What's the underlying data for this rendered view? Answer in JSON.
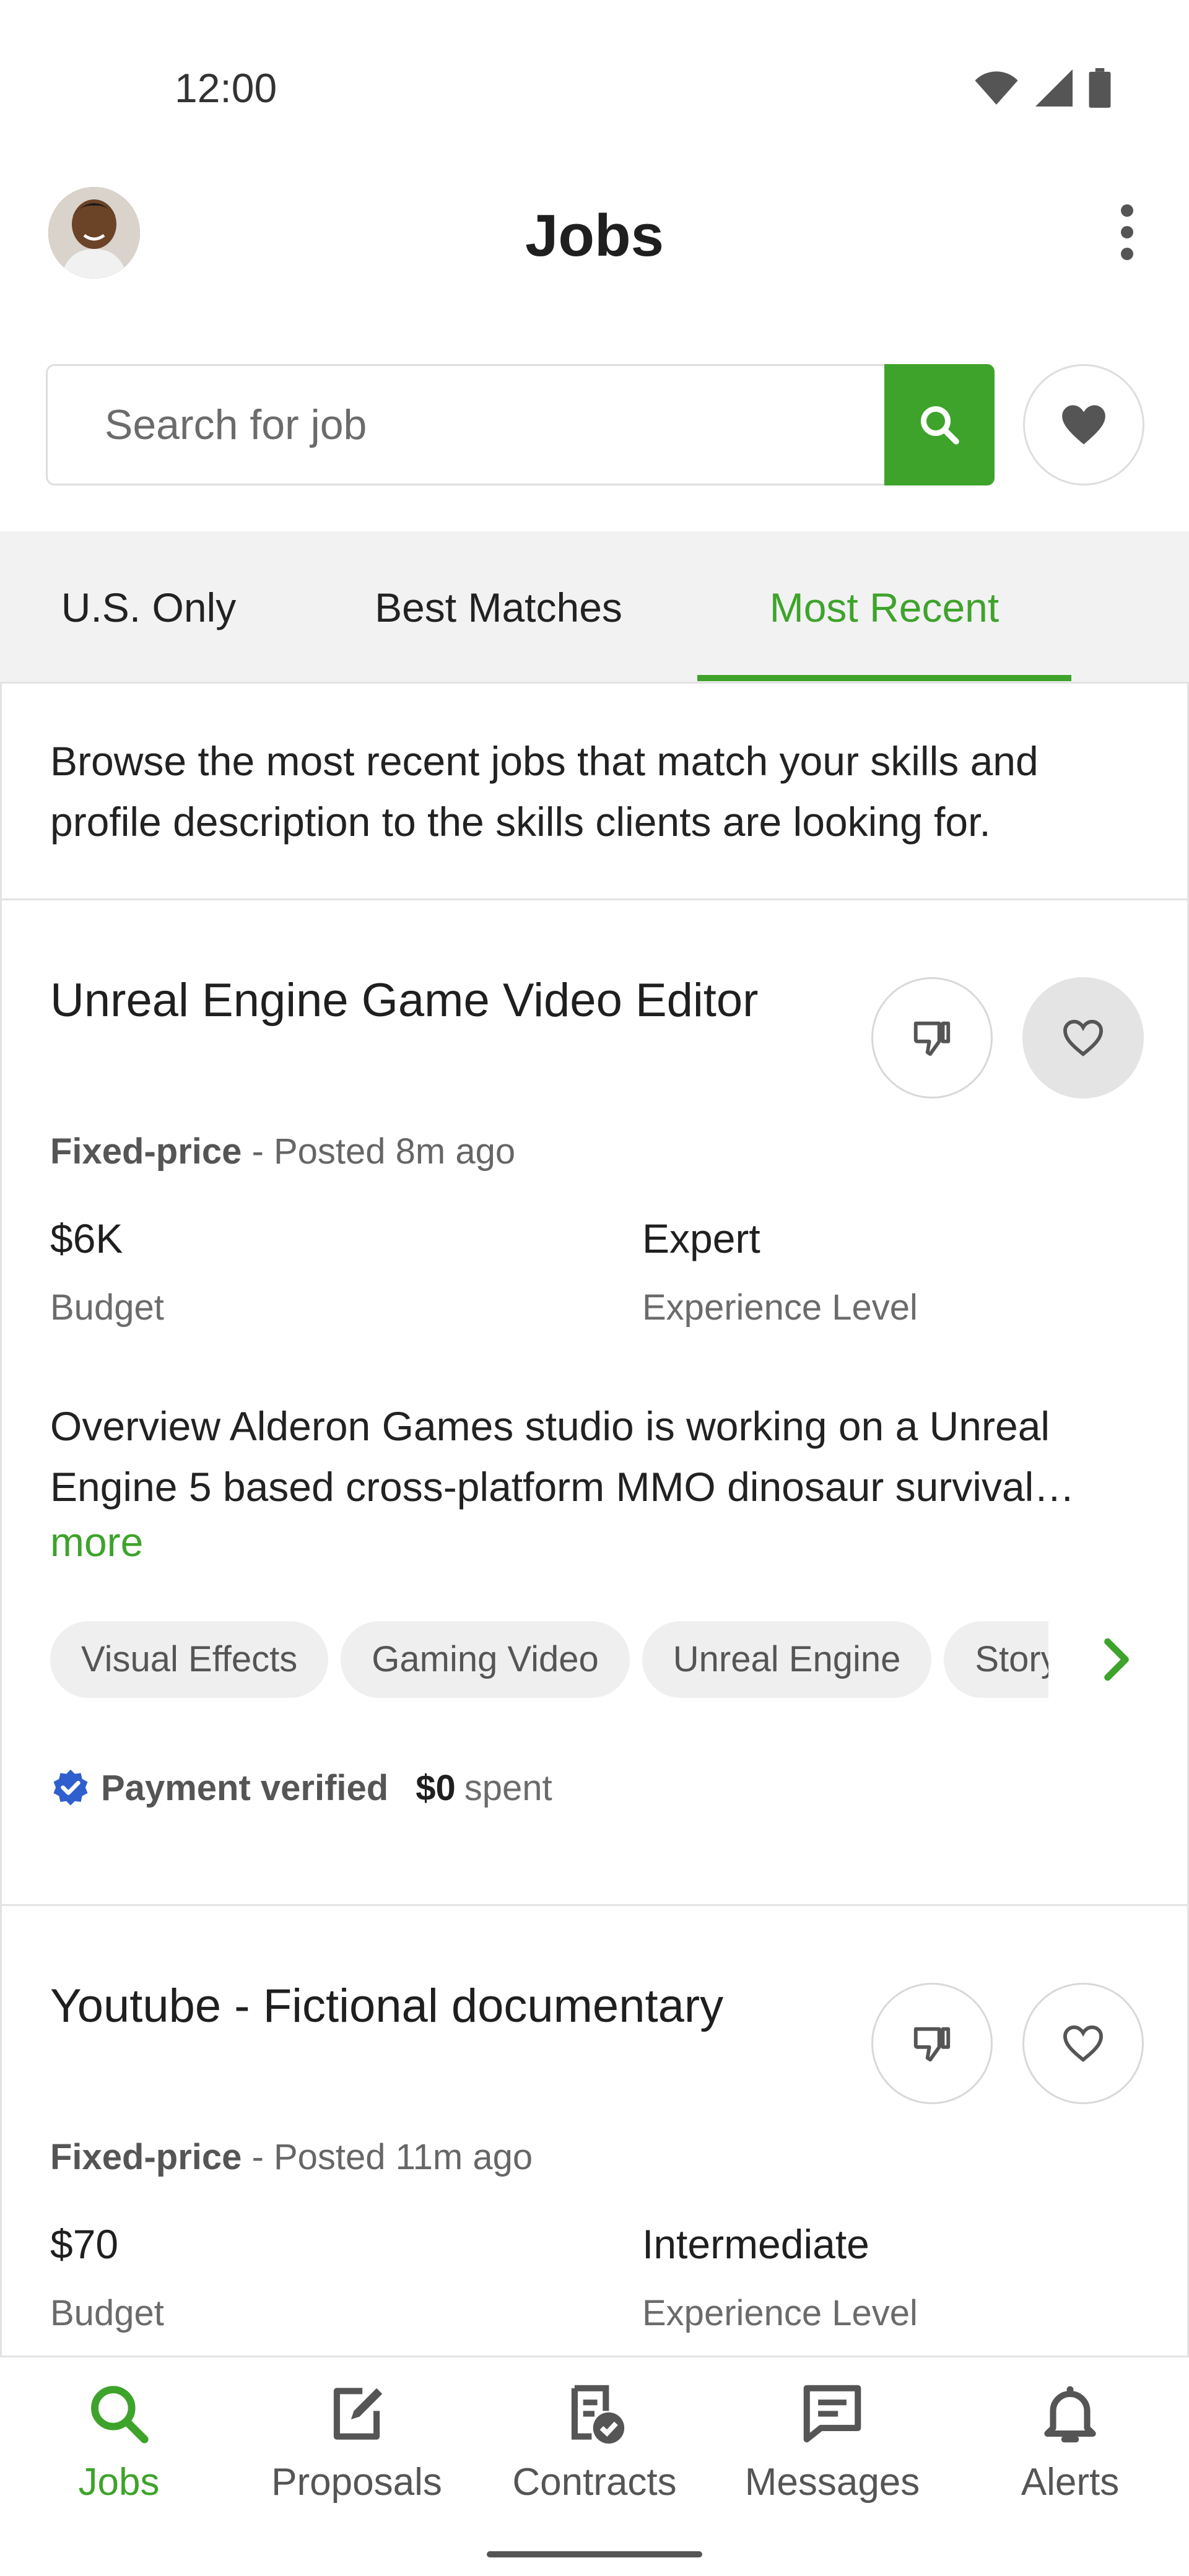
{
  "status_bar": {
    "time": "12:00"
  },
  "header": {
    "title": "Jobs"
  },
  "search": {
    "placeholder": "Search for job"
  },
  "tabs": [
    {
      "label": "U.S. Only",
      "active": false
    },
    {
      "label": "Best Matches",
      "active": false
    },
    {
      "label": "Most Recent",
      "active": true
    }
  ],
  "intro": "Browse the most recent jobs that match your skills and profile description to the skills clients are looking for.",
  "jobs": [
    {
      "title": "Unreal Engine Game Video Editor",
      "type": "Fixed-price",
      "posted": "- Posted 8m ago",
      "budget": "$6K",
      "budget_label": "Budget",
      "experience": "Expert",
      "experience_label": "Experience Level",
      "description": "Overview Alderon Games studio is working on a Unreal Engine 5 based cross-platform MMO dinosaur survival…",
      "more": "more",
      "skills": [
        "Visual Effects",
        "Gaming Video",
        "Unreal Engine",
        "Storyboarding"
      ],
      "payment": "Payment verified",
      "spent_amount": "$0",
      "spent_label": "spent",
      "saved": true
    },
    {
      "title": "Youtube - Fictional documentary",
      "type": "Fixed-price",
      "posted": "- Posted 11m ago",
      "budget": "$70",
      "budget_label": "Budget",
      "experience": "Intermediate",
      "experience_label": "Experience Level",
      "saved": false
    }
  ],
  "bottom_nav": [
    {
      "label": "Jobs",
      "icon": "search-icon",
      "active": true
    },
    {
      "label": "Proposals",
      "icon": "edit-document-icon",
      "active": false
    },
    {
      "label": "Contracts",
      "icon": "contract-check-icon",
      "active": false
    },
    {
      "label": "Messages",
      "icon": "message-icon",
      "active": false
    },
    {
      "label": "Alerts",
      "icon": "bell-icon",
      "active": false
    }
  ],
  "colors": {
    "accent": "#3ea32b",
    "verified": "#2f5fce"
  }
}
